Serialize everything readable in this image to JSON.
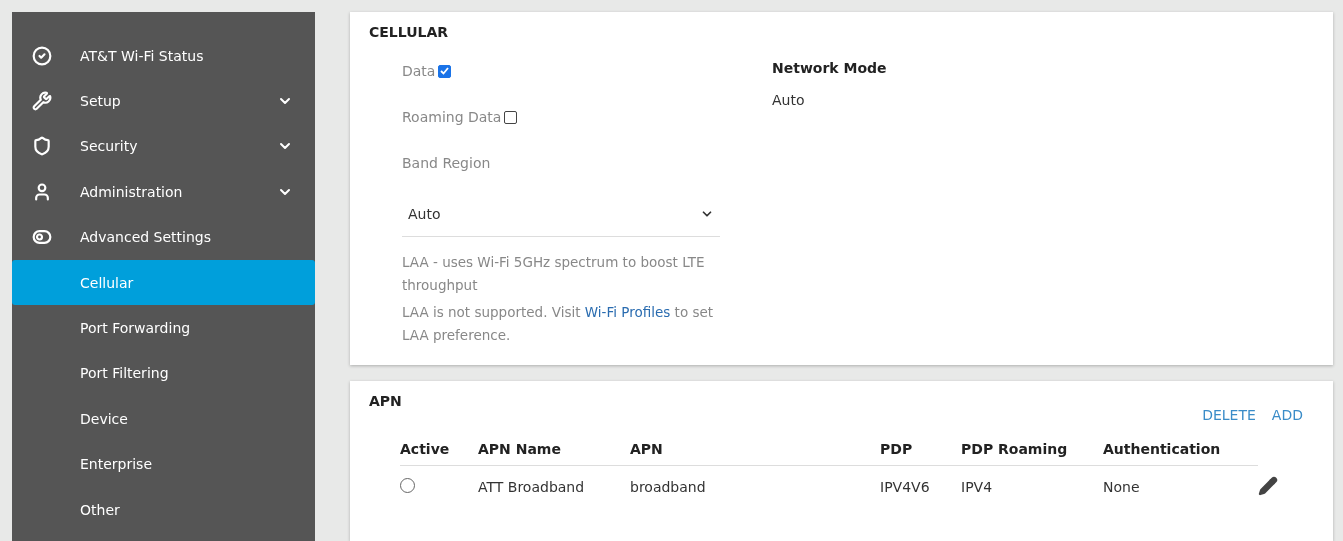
{
  "sidebar": {
    "items": [
      {
        "label": "AT&T Wi-Fi Status"
      },
      {
        "label": "Setup",
        "expanded": false
      },
      {
        "label": "Security",
        "expanded": false
      },
      {
        "label": "Administration",
        "expanded": false
      },
      {
        "label": "Advanced Settings",
        "expanded": true,
        "children": [
          {
            "label": "Cellular",
            "selected": true
          },
          {
            "label": "Port Forwarding",
            "selected": false
          },
          {
            "label": "Port Filtering",
            "selected": false
          },
          {
            "label": "Device",
            "selected": false
          },
          {
            "label": "Enterprise",
            "selected": false
          },
          {
            "label": "Other",
            "selected": false
          }
        ]
      }
    ]
  },
  "cellular": {
    "title": "CELLULAR",
    "data": {
      "label": "Data",
      "checked": true
    },
    "roaming": {
      "label": "Roaming Data",
      "checked": false
    },
    "band_region": {
      "label": "Band Region",
      "value": "Auto"
    },
    "note_1": "LAA - uses Wi-Fi 5GHz spectrum to boost LTE throughput",
    "note_2": {
      "before": "LAA is not supported. Visit ",
      "link": "Wi-Fi Profiles",
      "after": " to set LAA preference."
    },
    "network_mode": {
      "label": "Network Mode",
      "value": "Auto"
    }
  },
  "apn": {
    "title": "APN",
    "actions": [
      "DELETE",
      "ADD"
    ],
    "columns": [
      "Active",
      "APN Name",
      "APN",
      "PDP",
      "PDP Roaming",
      "Authentication"
    ],
    "rows": [
      {
        "selected": false,
        "cells": [
          "",
          "ATT Broadband",
          "broadband",
          "IPV4V6",
          "IPV4",
          "None"
        ]
      }
    ]
  }
}
